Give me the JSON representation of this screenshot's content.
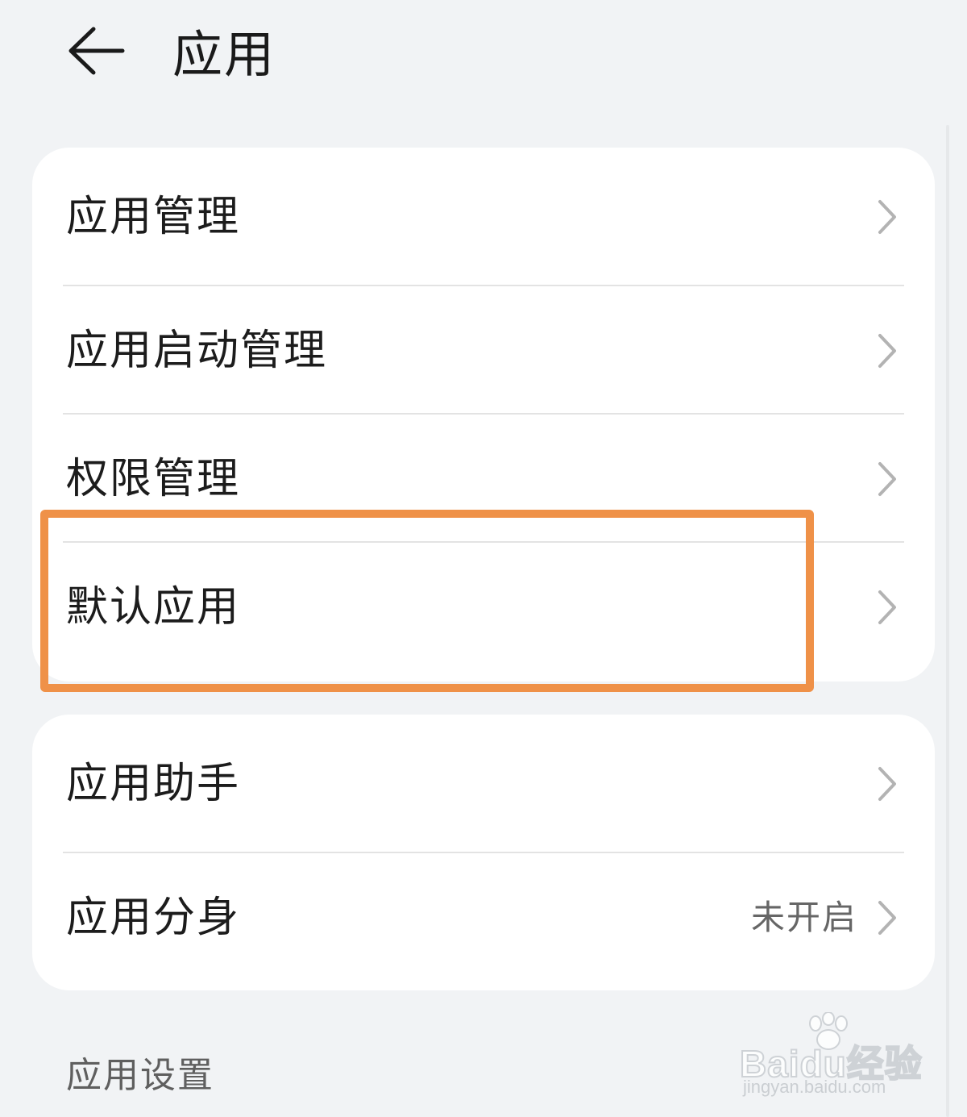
{
  "header": {
    "back_icon": "arrow-left-icon",
    "title": "应用"
  },
  "groups": [
    {
      "items": [
        {
          "label": "应用管理",
          "icon": "chevron-right-icon"
        },
        {
          "label": "应用启动管理",
          "icon": "chevron-right-icon"
        },
        {
          "label": "权限管理",
          "icon": "chevron-right-icon"
        },
        {
          "label": "默认应用",
          "icon": "chevron-right-icon",
          "highlighted": true
        }
      ]
    },
    {
      "items": [
        {
          "label": "应用助手",
          "icon": "chevron-right-icon"
        },
        {
          "label": "应用分身",
          "value": "未开启",
          "icon": "chevron-right-icon"
        }
      ]
    }
  ],
  "section_header": "应用设置",
  "watermark": {
    "brand": "Baidu经验",
    "url": "jingyan.baidu.com"
  },
  "colors": {
    "background": "#f1f3f5",
    "card": "#ffffff",
    "highlight": "#ef9148",
    "text_primary": "#1c1c1c",
    "text_secondary": "#666666"
  }
}
